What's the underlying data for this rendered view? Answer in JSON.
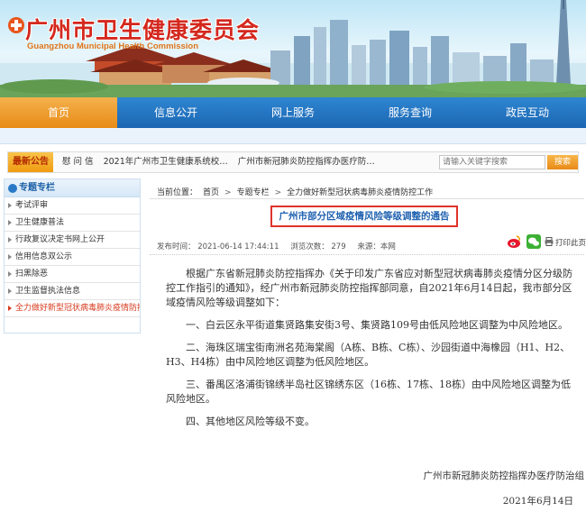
{
  "header": {
    "site_title": "广州市卫生健康委员会",
    "site_subtitle": "Guangzhou Municipal Health Commission"
  },
  "nav": {
    "items": [
      {
        "label": "首页",
        "active": true
      },
      {
        "label": "信息公开",
        "active": false
      },
      {
        "label": "网上服务",
        "active": false
      },
      {
        "label": "服务查询",
        "active": false
      },
      {
        "label": "政民互动",
        "active": false
      }
    ]
  },
  "notice": {
    "badge": "最新公告",
    "items": [
      "慰 问 信",
      "2021年广州市卫生健康系统校…",
      "广州市新冠肺炎防控指挥办医疗防…"
    ]
  },
  "search": {
    "placeholder": "请输入关键字搜索",
    "button_label": "搜索"
  },
  "sidebar": {
    "title": "专题专栏",
    "items": [
      {
        "label": "考试评审",
        "active": false
      },
      {
        "label": "卫生健康普法",
        "active": false
      },
      {
        "label": "行政复议决定书网上公开",
        "active": false
      },
      {
        "label": "信用信息双公示",
        "active": false
      },
      {
        "label": "扫黑除恶",
        "active": false
      },
      {
        "label": "卫生监督执法信息",
        "active": false
      },
      {
        "label": "全力做好新型冠状病毒肺炎疫情防控工作",
        "active": true
      }
    ]
  },
  "breadcrumb": {
    "prefix": "当前位置：",
    "items": [
      "首页",
      "专题专栏",
      "全力做好新型冠状病毒肺炎疫情防控工作"
    ],
    "separator": ">"
  },
  "article": {
    "title": "广州市部分区域疫情风险等级调整的通告",
    "meta": {
      "publish_time": "发布时间：  2021-06-14 17:44:11",
      "views": "浏览次数：  279",
      "source": "来源：本网"
    },
    "print_label": "打印此页",
    "paragraphs": [
      "根据广东省新冠肺炎防控指挥办《关于印发广东省应对新型冠状病毒肺炎疫情分区分级防控工作指引的通知》，经广州市新冠肺炎防控指挥部同意，自2021年6月14日起，我市部分区域疫情风险等级调整如下：",
      "一、白云区永平街道集贤路集安街3号、集贤路109号由低风险地区调整为中风险地区。",
      "二、海珠区瑞宝街南洲名苑海棠阁（A栋、B栋、C栋）、沙园街道中海橡园（H1、H2、H3、H4栋）由中风险地区调整为低风险地区。",
      "三、番禺区洛浦街锦绣半岛社区锦绣东区（16栋、17栋、18栋）由中风险地区调整为低风险地区。",
      "四、其他地区风险等级不变。"
    ],
    "signature_org": "广州市新冠肺炎防控指挥办医疗防治组",
    "signature_date": "2021年6月14日"
  },
  "colors": {
    "brand_red": "#d4281e",
    "nav_blue": "#1b66b3",
    "nav_active": "#e88b16",
    "title_border": "#e0332a",
    "title_text": "#2062b0"
  }
}
